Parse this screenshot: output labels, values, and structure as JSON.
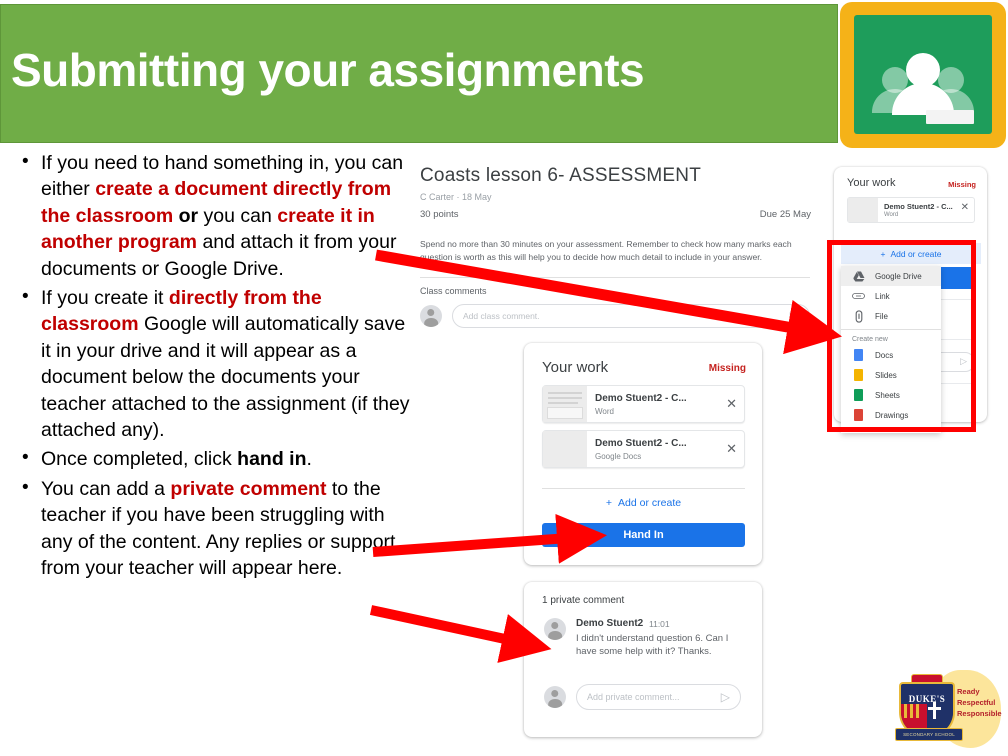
{
  "slide": {
    "title": "Submitting your assignments",
    "header_color": "#70ad47",
    "accent_color": "#c00000",
    "logo_name": "google-classroom-logo"
  },
  "bullets": [
    {
      "id": "bullet-create",
      "segments": [
        {
          "text": "If you need  to hand something in, you can either ",
          "style": "normal"
        },
        {
          "text": "create a document directly from the classroom",
          "style": "highlight"
        },
        {
          "text": " or",
          "style": "bold"
        },
        {
          "text": " you can ",
          "style": "normal"
        },
        {
          "text": "create it in another program",
          "style": "highlight"
        },
        {
          "text": " and attach it from your documents or Google Drive.",
          "style": "normal"
        }
      ]
    },
    {
      "id": "bullet-autosave",
      "segments": [
        {
          "text": "If you create it ",
          "style": "normal"
        },
        {
          "text": "directly from the classroom",
          "style": "highlight"
        },
        {
          "text": " Google will automatically save it in your drive and it will appear as a document below the documents your teacher attached to the assignment (if they attached any).",
          "style": "normal"
        }
      ]
    },
    {
      "id": "bullet-handin",
      "segments": [
        {
          "text": "Once completed, click ",
          "style": "normal"
        },
        {
          "text": "hand in",
          "style": "bold"
        },
        {
          "text": ".",
          "style": "normal"
        }
      ]
    },
    {
      "id": "bullet-private-comment",
      "segments": [
        {
          "text": "You can add a ",
          "style": "normal"
        },
        {
          "text": "private comment",
          "style": "highlight"
        },
        {
          "text": " to the teacher if you have been struggling with any of the content. Any replies or support from your teacher will appear here.",
          "style": "normal"
        }
      ]
    }
  ],
  "assignment": {
    "title": "Coasts lesson 6- ASSESSMENT",
    "meta": "C Carter · 18 May",
    "points": "30 points",
    "due": "Due 25 May",
    "description": "Spend no more than 30 minutes on your assessment. Remember to check how many marks each question is worth as this will help you to decide how much detail to include in your answer.",
    "class_comments_label": "Class comments",
    "comment_placeholder": "Add class comment.",
    "send_icon": "send-icon",
    "avatar": "user-avatar"
  },
  "work_card": {
    "title": "Your work",
    "status": "Missing",
    "status_color": "#c5221f",
    "attachments": [
      {
        "name": "Demo Stuent2 - C...",
        "type": "Word",
        "remove_icon": "close-icon"
      },
      {
        "name": "Demo Stuent2 - C...",
        "type": "Google Docs",
        "remove_icon": "close-icon"
      }
    ],
    "add_or_create": "Add or create",
    "add_icon": "plus-icon",
    "hand_in": "Hand In",
    "hand_in_color": "#1a73e8"
  },
  "right_panel": {
    "title": "Your work",
    "status": "Missing",
    "attachment": {
      "name": "Demo Stuent2 - C...",
      "type": "Word",
      "remove_icon": "close-icon"
    },
    "add_or_create": "Add or create",
    "add_icon": "plus-icon",
    "menu": {
      "attach_items": [
        {
          "label": "Google Drive",
          "icon": "google-drive-icon",
          "selected": true
        },
        {
          "label": "Link",
          "icon": "link-icon",
          "selected": false
        },
        {
          "label": "File",
          "icon": "file-upload-icon",
          "selected": false
        }
      ],
      "create_new_label": "Create new",
      "create_items": [
        {
          "label": "Docs",
          "icon": "google-docs-icon",
          "color": "#4285f4"
        },
        {
          "label": "Slides",
          "icon": "google-slides-icon",
          "color": "#f4b400"
        },
        {
          "label": "Sheets",
          "icon": "google-sheets-icon",
          "color": "#0f9d58"
        },
        {
          "label": "Drawings",
          "icon": "google-drawings-icon",
          "color": "#db4437"
        }
      ]
    },
    "highlight_box_color": "#ff0000"
  },
  "private_comments": {
    "title": "1 private comment",
    "author": "Demo Stuent2",
    "time": "11:01",
    "body": "I didn't understand question 6. Can I have some help with it? Thanks.",
    "placeholder": "Add private comment...",
    "send_icon": "send-icon",
    "avatar": "user-avatar"
  },
  "annotations": {
    "arrow_color": "#ff0000",
    "arrows": [
      {
        "name": "arrow-to-add-or-create"
      },
      {
        "name": "arrow-to-hand-in"
      },
      {
        "name": "arrow-to-private-comment"
      }
    ]
  },
  "crest": {
    "name": "DUKE'S",
    "banner": "SECONDARY SCHOOL",
    "motto_lines": [
      "Ready",
      "Respectful",
      "Responsible"
    ]
  }
}
